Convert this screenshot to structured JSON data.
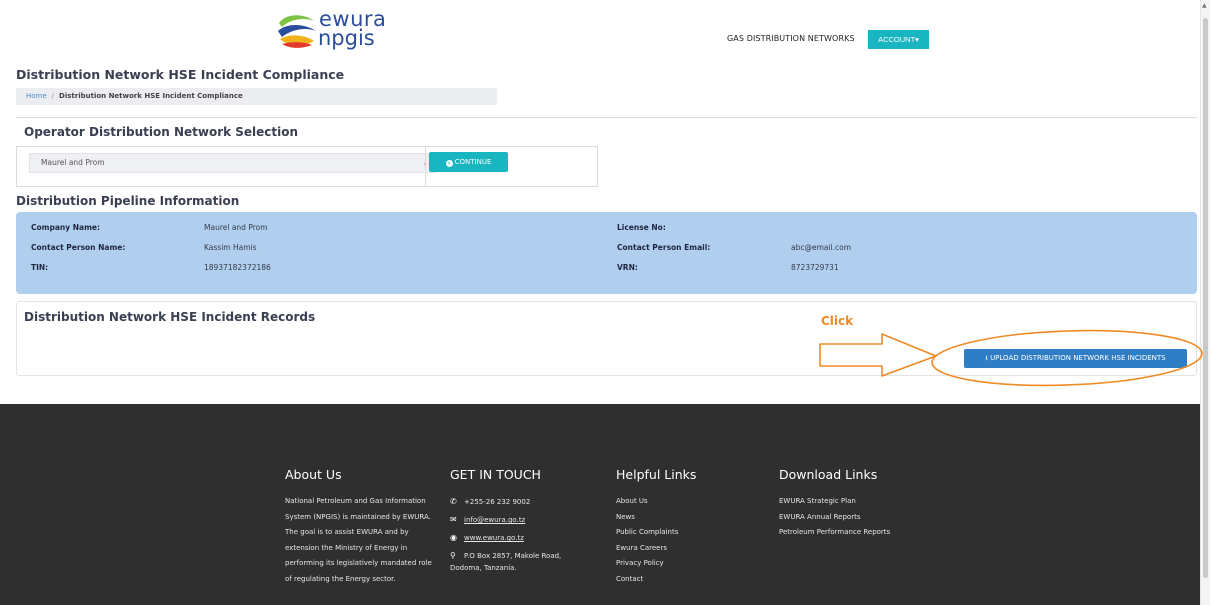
{
  "header": {
    "logo_top": "ewura",
    "logo_bottom": "npgis",
    "nav_link": "GAS DISTRIBUTION NETWORKS",
    "account_label": "ACCOUNT▾"
  },
  "page_title": "Distribution Network HSE Incident Compliance",
  "breadcrumb": {
    "home": "Home",
    "separator": "/",
    "current": "Distribution Network HSE Incident Compliance"
  },
  "operator_selection": {
    "title": "Operator Distribution Network Selection",
    "selected_value": "Maurel and Prom",
    "continue_label": "CONTINUE"
  },
  "pipeline_info": {
    "title": "Distribution Pipeline Information",
    "company_name_label": "Company Name:",
    "company_name": "Maurel and Prom",
    "contact_person_label": "Contact Person Name:",
    "contact_person": "Kassim Hamis",
    "tin_label": "TIN:",
    "tin": "18937182372186",
    "license_label": "License No:",
    "license": "",
    "contact_email_label": "Contact Person Email:",
    "contact_email": "abc@email.com",
    "vrn_label": "VRN:",
    "vrn": "8723729731"
  },
  "records": {
    "title": "Distribution Network HSE Incident Records",
    "upload_label": "UPLOAD DISTRIBUTION NETWORK HSE INCIDENTS"
  },
  "annotation": {
    "click_label": "Click",
    "color": "#f08a24"
  },
  "footer": {
    "about": {
      "title": "About Us",
      "lines": [
        "National Petroleum and Gas Information",
        "System (NPGIS) is maintained by EWURA.",
        "The goal is to assist EWURA and by",
        "extension the Ministry of Energy in",
        "performing its legislatively mandated role",
        "of regulating the Energy sector."
      ]
    },
    "contact": {
      "title": "GET IN TOUCH",
      "phone": "+255-26 232 9002",
      "email": "info@ewura.go.tz",
      "website": "www.ewura.go.tz",
      "address_line1": "P.O Box 2857, Makole Road,",
      "address_line2": "Dodoma, Tanzania."
    },
    "helpful": {
      "title": "Helpful Links",
      "items": [
        "About Us",
        "News",
        "Public Complaints",
        "Ewura Careers",
        "Privacy Policy",
        "Contact"
      ]
    },
    "download": {
      "title": "Download Links",
      "items": [
        "EWURA Strategic Plan",
        "EWURA Annual Reports",
        "Petroleum Performance Reports"
      ]
    }
  },
  "colors": {
    "accent_teal": "#19b5c0",
    "primary_blue": "#2f7dc4",
    "info_panel": "#b0cfee",
    "footer_bg": "#2f2f2f"
  }
}
